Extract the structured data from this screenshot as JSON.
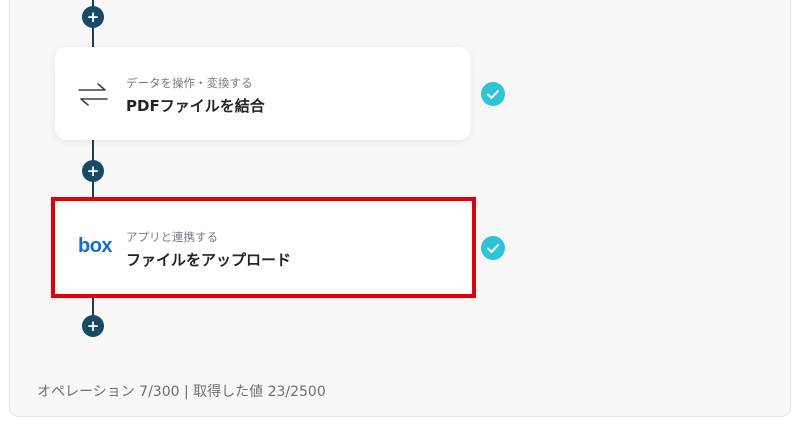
{
  "steps": [
    {
      "category": "データを操作・変換する",
      "title": "PDFファイルを結合",
      "icon": "swap-arrows-icon"
    },
    {
      "category": "アプリと連携する",
      "title": "ファイルをアップロード",
      "icon": "box-logo",
      "logo_text": "box"
    }
  ],
  "footer": {
    "text": "オペレーション 7/300 | 取得した値 23/2500"
  },
  "colors": {
    "connector": "#1e3d52",
    "add_button": "#174a63",
    "check": "#2dc3d8",
    "highlight": "#e0000b",
    "box_brand": "#0f6fd6"
  }
}
